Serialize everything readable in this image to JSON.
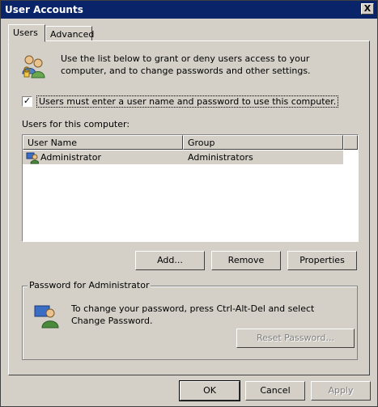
{
  "window": {
    "title": "User Accounts",
    "close_label": "X"
  },
  "tabs": [
    {
      "label": "Users",
      "active": true
    },
    {
      "label": "Advanced",
      "active": false
    }
  ],
  "intro_text": "Use the list below to grant or deny users access to your computer, and to change passwords and other settings.",
  "require_login": {
    "label": "Users must enter a user name and password to use this computer.",
    "checked": true,
    "mark": "✓"
  },
  "users_list": {
    "label": "Users for this computer:",
    "columns": [
      "User Name",
      "Group"
    ],
    "rows": [
      {
        "user_name": "Administrator",
        "group": "Administrators"
      }
    ]
  },
  "buttons": {
    "add": "Add...",
    "remove": "Remove",
    "properties": "Properties"
  },
  "password_group": {
    "title": "Password for Administrator",
    "text": "To change your password, press Ctrl-Alt-Del and select Change Password.",
    "reset_button": "Reset Password..."
  },
  "dialog_buttons": {
    "ok": "OK",
    "cancel": "Cancel",
    "apply": "Apply"
  },
  "colors": {
    "titlebar": "#0a246a",
    "dialog_bg": "#d4d0c8"
  }
}
